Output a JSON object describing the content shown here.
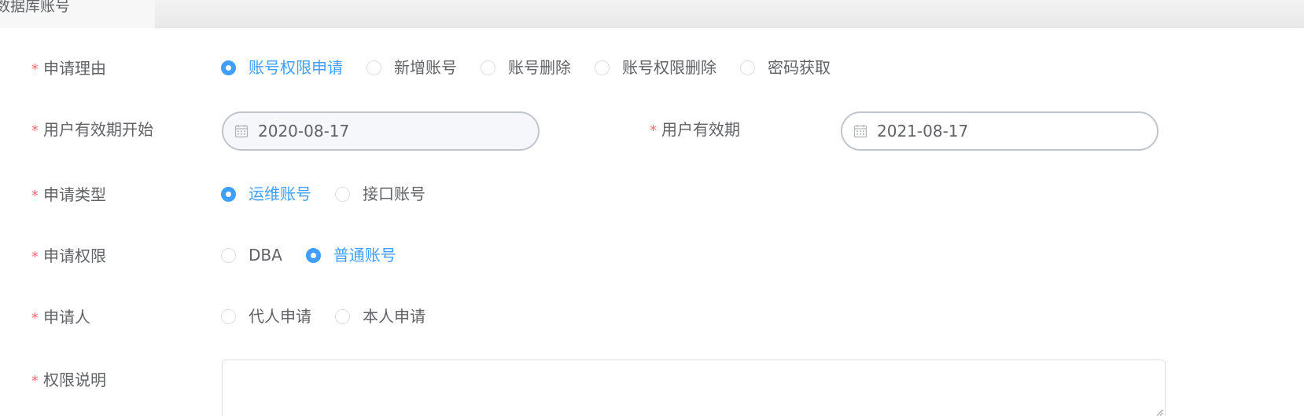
{
  "tab": {
    "label": "数据库账号"
  },
  "form": {
    "reason": {
      "required_mark": "*",
      "label": "申请理由",
      "options": [
        "账号权限申请",
        "新增账号",
        "账号删除",
        "账号权限删除",
        "密码获取"
      ],
      "selected": "账号权限申请"
    },
    "valid_start": {
      "required_mark": "*",
      "label": "用户有效期开始",
      "value": "2020-08-17",
      "icon": "calendar-icon"
    },
    "valid_end": {
      "required_mark": "*",
      "label": "用户有效期",
      "value": "2021-08-17",
      "icon": "calendar-icon"
    },
    "apply_type": {
      "required_mark": "*",
      "label": "申请类型",
      "options": [
        "运维账号",
        "接口账号"
      ],
      "selected": "运维账号"
    },
    "permission": {
      "required_mark": "*",
      "label": "申请权限",
      "options": [
        "DBA",
        "普通账号"
      ],
      "selected": "普通账号"
    },
    "applicant": {
      "required_mark": "*",
      "label": "申请人",
      "options": [
        "代人申请",
        "本人申请"
      ],
      "selected": ""
    },
    "description": {
      "required_mark": "*",
      "label": "权限说明",
      "value": ""
    }
  },
  "colors": {
    "primary": "#409eff",
    "required": "#f56c6c",
    "text": "#606266",
    "border": "#dcdfe6"
  }
}
